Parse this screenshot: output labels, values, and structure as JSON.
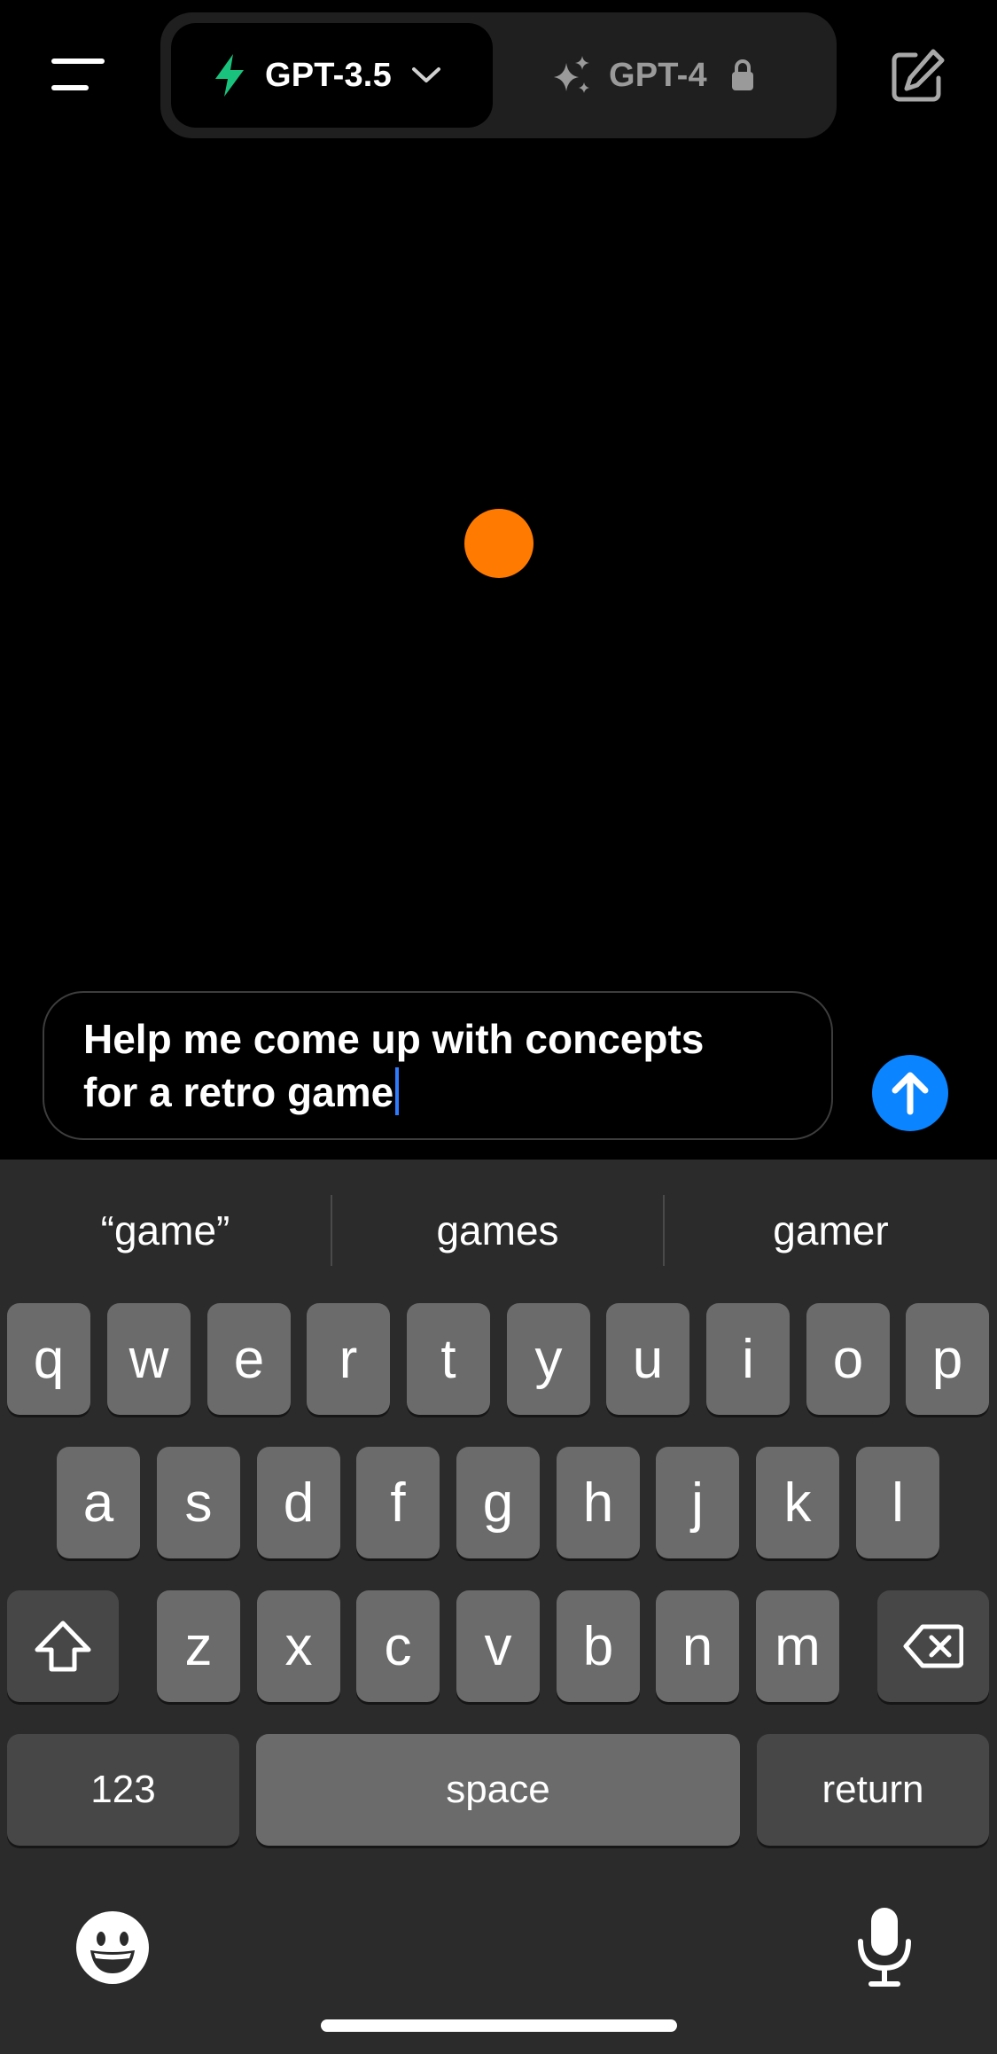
{
  "header": {
    "models": [
      {
        "label": "GPT-3.5",
        "icon": "bolt-icon",
        "active": true
      },
      {
        "label": "GPT-4",
        "icon": "sparkle-icon",
        "active": false,
        "locked": true
      }
    ]
  },
  "composer": {
    "text_line1": "Help me come up with concepts",
    "text_line2": "for a retro game"
  },
  "keyboard": {
    "suggestions": [
      "“game”",
      "games",
      "gamer"
    ],
    "row1": [
      "q",
      "w",
      "e",
      "r",
      "t",
      "y",
      "u",
      "i",
      "o",
      "p"
    ],
    "row2": [
      "a",
      "s",
      "d",
      "f",
      "g",
      "h",
      "j",
      "k",
      "l"
    ],
    "row3": [
      "z",
      "x",
      "c",
      "v",
      "b",
      "n",
      "m"
    ],
    "numbers_label": "123",
    "space_label": "space",
    "return_label": "return"
  },
  "colors": {
    "accent_bolt": "#19c37d",
    "send_button": "#0a84ff",
    "orb": "#ff7a00"
  }
}
